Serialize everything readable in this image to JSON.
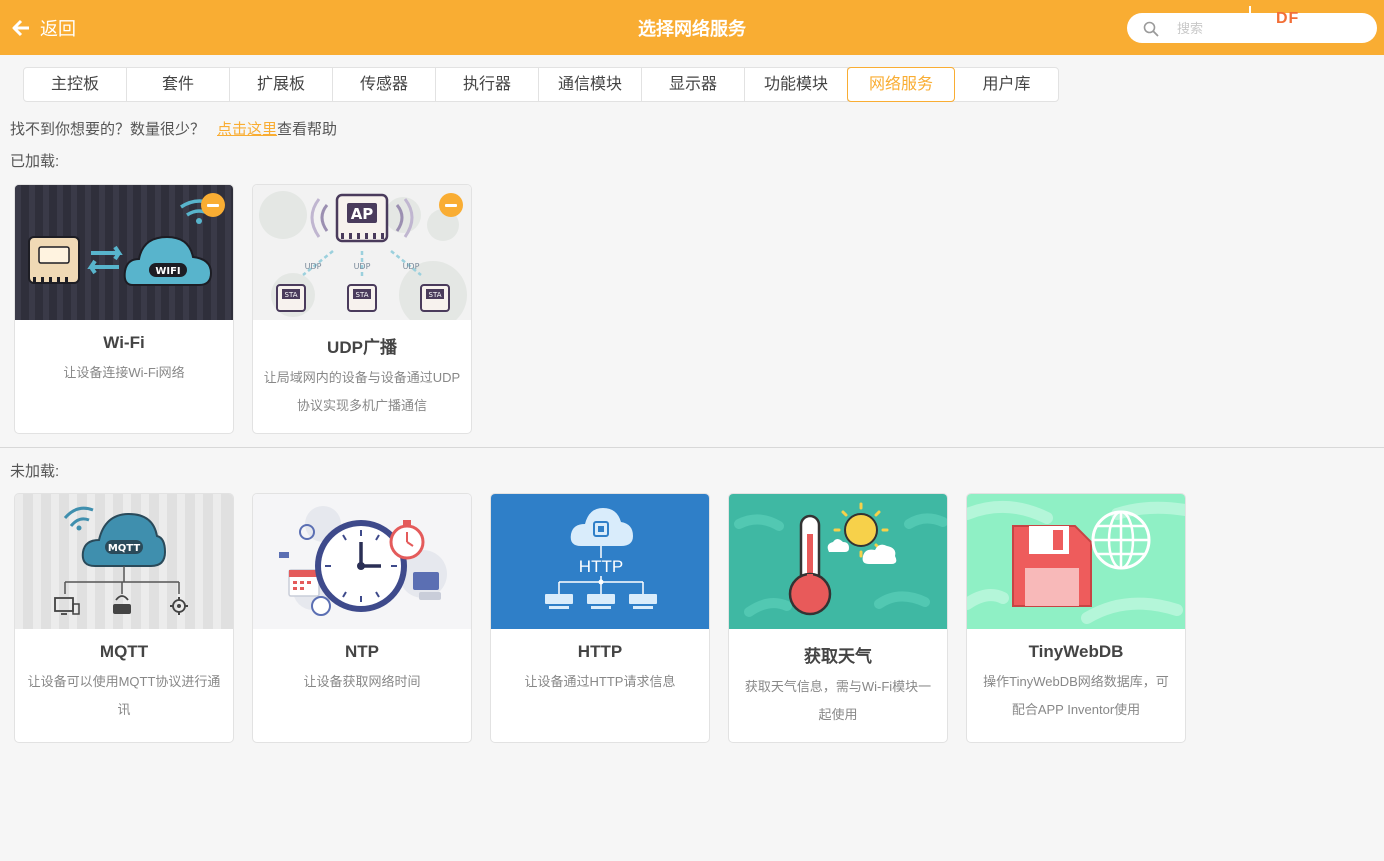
{
  "header": {
    "back_label": "返回",
    "title": "选择网络服务",
    "search_placeholder": "搜索",
    "brand": "DF"
  },
  "tabs": [
    {
      "label": "主控板"
    },
    {
      "label": "套件"
    },
    {
      "label": "扩展板"
    },
    {
      "label": "传感器"
    },
    {
      "label": "执行器"
    },
    {
      "label": "通信模块"
    },
    {
      "label": "显示器"
    },
    {
      "label": "功能模块"
    },
    {
      "label": "网络服务",
      "active": true
    },
    {
      "label": "用户库"
    }
  ],
  "help": {
    "text": "找不到你想要的？数量很少？",
    "link": "点击这里",
    "suffix": "查看帮助"
  },
  "loaded": {
    "label": "已加载:",
    "cards": [
      {
        "name": "Wi-Fi",
        "desc": "让设备连接Wi-Fi网络",
        "thumb_text": "WIFI"
      },
      {
        "name": "UDP广播",
        "desc": "让局域网内的设备与设备通过UDP协议实现多机广播通信",
        "thumb_text": "AP",
        "thumb_sub": "UDP",
        "thumb_node": "STA"
      }
    ]
  },
  "unloaded": {
    "label": "未加载:",
    "cards": [
      {
        "name": "MQTT",
        "desc": "让设备可以使用MQTT协议进行通讯",
        "thumb_text": "MQTT"
      },
      {
        "name": "NTP",
        "desc": "让设备获取网络时间"
      },
      {
        "name": "HTTP",
        "desc": "让设备通过HTTP请求信息",
        "thumb_text": "HTTP"
      },
      {
        "name": "获取天气",
        "desc": "获取天气信息，需与Wi-Fi模块一起使用"
      },
      {
        "name": "TinyWebDB",
        "desc": "操作TinyWebDB网络数据库，可配合APP Inventor使用"
      }
    ]
  },
  "colors": {
    "accent": "#f9ad33",
    "brand": "#f26f37"
  }
}
